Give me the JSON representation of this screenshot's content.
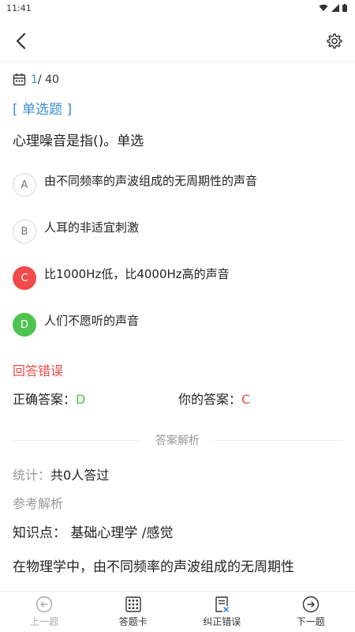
{
  "status_bar": {
    "time": "11:41"
  },
  "counter": {
    "current": "1",
    "total": "/ 40"
  },
  "question": {
    "type": "[ 单选题 ]",
    "text": "心理噪音是指()。单选"
  },
  "options": [
    {
      "letter": "A",
      "text": "由不同频率的声波组成的无周期性的声音",
      "state": "normal"
    },
    {
      "letter": "B",
      "text": "人耳的非适宜刺激",
      "state": "normal"
    },
    {
      "letter": "C",
      "text": "比1000Hz低，比4000Hz高的声音",
      "state": "wrong"
    },
    {
      "letter": "D",
      "text": "人们不愿听的声音",
      "state": "correct"
    }
  ],
  "result": {
    "status": "回答错误",
    "correct_label": "正确答案：",
    "correct_value": "D",
    "yours_label": "你的答案：",
    "yours_value": "C"
  },
  "analysis": {
    "divider": "答案解析",
    "stats_label": "统计：",
    "stats_value": "共0人答过",
    "reference": "参考解析",
    "knowledge_label": "知识点：",
    "knowledge_value": "基础心理学 /感觉",
    "body": "在物理学中，由不同频率的声波组成的无周期性"
  },
  "bottom_nav": {
    "prev": "上一题",
    "card": "答题卡",
    "report": "纠正错误",
    "next": "下一题"
  },
  "colors": {
    "accent": "#3b8ed8",
    "wrong": "#f04a4a",
    "correct": "#4fc34f"
  }
}
